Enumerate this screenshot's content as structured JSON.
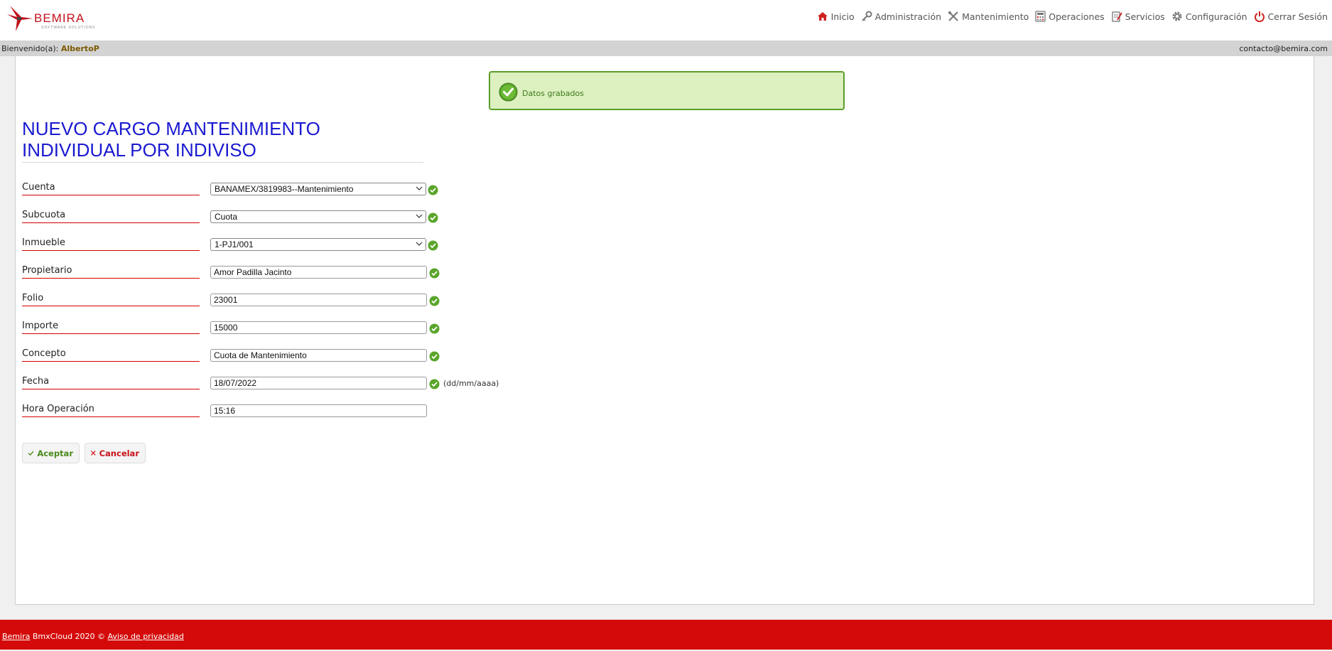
{
  "brand": {
    "logo_text": "BEMIRA",
    "logo_sub": "SOFTWARE SOLUTIONS"
  },
  "nav": {
    "items": [
      {
        "label": "Inicio",
        "icon": "home-icon"
      },
      {
        "label": "Administración",
        "icon": "key-icon"
      },
      {
        "label": "Mantenimiento",
        "icon": "tools-icon"
      },
      {
        "label": "Operaciones",
        "icon": "calculator-icon"
      },
      {
        "label": "Servicios",
        "icon": "notepad-icon"
      },
      {
        "label": "Configuración",
        "icon": "gear-icon"
      },
      {
        "label": "Cerrar Sesión",
        "icon": "power-icon"
      }
    ]
  },
  "welcome": {
    "prefix": "Bienvenido(a):",
    "user": "AlbertoP",
    "contact": "contacto@bemira.com"
  },
  "alert": {
    "message": "Datos grabados"
  },
  "page": {
    "title_line1": "NUEVO CARGO MANTENIMIENTO",
    "title_line2": "INDIVIDUAL POR INDIVISO"
  },
  "form": {
    "cuenta": {
      "label": "Cuenta",
      "value": "BANAMEX/3819983--Mantenimiento"
    },
    "subcuota": {
      "label": "Subcuota",
      "value": "Cuota"
    },
    "inmueble": {
      "label": "Inmueble",
      "value": "1-PJ1/001"
    },
    "propietario": {
      "label": "Propietario",
      "value": "Amor Padilla Jacinto"
    },
    "folio": {
      "label": "Folio",
      "value": "23001"
    },
    "importe": {
      "label": "Importe",
      "value": "15000"
    },
    "concepto": {
      "label": "Concepto",
      "value": "Cuota de Mantenimiento"
    },
    "fecha": {
      "label": "Fecha",
      "value": "18/07/2022",
      "hint": "(dd/mm/aaaa)"
    },
    "hora": {
      "label": "Hora Operación",
      "value": "15:16"
    }
  },
  "buttons": {
    "accept": "Aceptar",
    "cancel": "Cancelar"
  },
  "footer": {
    "brand_link": "Bemira",
    "copyright": " BmxCloud 2020 © ",
    "privacy_link": "Aviso de privacidad"
  },
  "colors": {
    "title": "#1a1ad0",
    "footer": "#d40a0a",
    "alert_bg": "#dcf0c0",
    "alert_border": "#5a9e2a",
    "label_underline": "#d40000"
  }
}
